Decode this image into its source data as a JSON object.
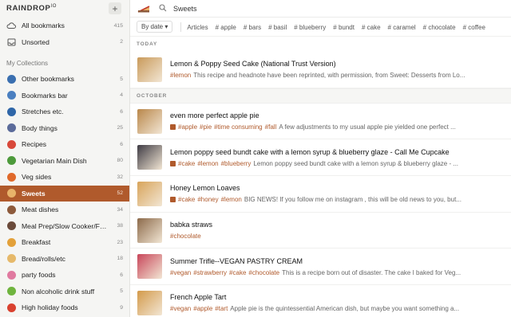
{
  "app": {
    "logo_text": "RAINDROP",
    "logo_version": "IO",
    "add_label": "+"
  },
  "sidebar": {
    "top_items": [
      {
        "label": "All bookmarks",
        "count": "415",
        "icon": "cloud-icon"
      },
      {
        "label": "Unsorted",
        "count": "2",
        "icon": "inbox-icon"
      }
    ],
    "section_label": "My Collections",
    "collections": [
      {
        "label": "Other bookmarks",
        "count": "5",
        "icon": "globe-icon",
        "color": "#3a6fb0"
      },
      {
        "label": "Bookmarks bar",
        "count": "4",
        "icon": "globe-icon",
        "color": "#4a7fc0"
      },
      {
        "label": "Stretches etc.",
        "count": "6",
        "icon": "globe-icon",
        "color": "#2f66a8"
      },
      {
        "label": "Body things",
        "count": "25",
        "icon": "laptop-icon",
        "color": "#5b6b9a"
      },
      {
        "label": "Recipes",
        "count": "6",
        "icon": "hills-icon",
        "color": "#d8483a"
      },
      {
        "label": "Vegetarian Main Dish",
        "count": "80",
        "icon": "salad-icon",
        "color": "#4d9a3b"
      },
      {
        "label": "Veg sides",
        "count": "32",
        "icon": "pizza-icon",
        "color": "#e0692a"
      },
      {
        "label": "Sweets",
        "count": "52",
        "icon": "cake-slice-icon",
        "color": "#e8b36a"
      },
      {
        "label": "Meat dishes",
        "count": "34",
        "icon": "meat-icon",
        "color": "#8d5a3b"
      },
      {
        "label": "Meal Prep/Slow Cooker/Fre...",
        "count": "38",
        "icon": "pot-icon",
        "color": "#6a4a3a"
      },
      {
        "label": "Breakfast",
        "count": "23",
        "icon": "croissant-icon",
        "color": "#e3a13a"
      },
      {
        "label": "Bread/rolls/etc",
        "count": "18",
        "icon": "bread-icon",
        "color": "#e6b96a"
      },
      {
        "label": "party foods",
        "count": "6",
        "icon": "donut-icon",
        "color": "#e07aa0"
      },
      {
        "label": "Non alcoholic drink stuff",
        "count": "5",
        "icon": "drink-icon",
        "color": "#6fb43e"
      },
      {
        "label": "High holiday foods",
        "count": "9",
        "icon": "apple-icon",
        "color": "#d9412f"
      }
    ]
  },
  "toolbar": {
    "search_value": "Sweets",
    "sort_label": "By date",
    "chips": [
      "Articles",
      "# apple",
      "# bars",
      "# basil",
      "# blueberry",
      "# bundt",
      "# cake",
      "# caramel",
      "# chocolate",
      "# coffee"
    ]
  },
  "sections": {
    "today": "TODAY",
    "october": "OCTOBER"
  },
  "bookmarks": [
    {
      "title": "Lemon & Poppy Seed Cake (National Trust Version)",
      "has_icon": false,
      "tags": [
        "#lemon"
      ],
      "excerpt": "This recipe and headnote have been reprinted, with permission, from Sweet: Desserts from Lo...",
      "thumb": "#c99a5a"
    },
    {
      "title": "even more perfect apple pie",
      "has_icon": true,
      "tags": [
        "#apple",
        "#pie",
        "#time consuming",
        "#fall"
      ],
      "excerpt": "A few adjustments to my usual apple pie yielded one perfect ...",
      "thumb": "#b9874a"
    },
    {
      "title": "Lemon poppy seed bundt cake with a lemon syrup & blueberry glaze - Call Me Cupcake",
      "has_icon": true,
      "tags": [
        "#cake",
        "#lemon",
        "#blueberry"
      ],
      "excerpt": "Lemon poppy seed bundt cake with a lemon syrup & blueberry glaze - ...",
      "thumb": "#3e3b44"
    },
    {
      "title": "Honey Lemon Loaves",
      "has_icon": true,
      "tags": [
        "#cake",
        "#honey",
        "#lemon"
      ],
      "excerpt": "BIG NEWS! If you follow me on instagram , this will be old news to you, but...",
      "thumb": "#d8a45a"
    },
    {
      "title": "babka straws",
      "has_icon": false,
      "tags": [
        "#chocolate"
      ],
      "excerpt": "",
      "thumb": "#8c6a4a"
    },
    {
      "title": "Summer Trifle--VEGAN PASTRY CREAM",
      "has_icon": false,
      "tags": [
        "#vegan",
        "#strawberry",
        "#cake",
        "#chocolate"
      ],
      "excerpt": "This is a recipe born out of disaster. The cake I baked for Veg...",
      "thumb": "#c8465a"
    },
    {
      "title": "French Apple Tart",
      "has_icon": false,
      "tags": [
        "#vegan",
        "#apple",
        "#tart"
      ],
      "excerpt": "Apple pie is the quintessential American dish, but maybe you want something a...",
      "thumb": "#d39a4a"
    }
  ]
}
